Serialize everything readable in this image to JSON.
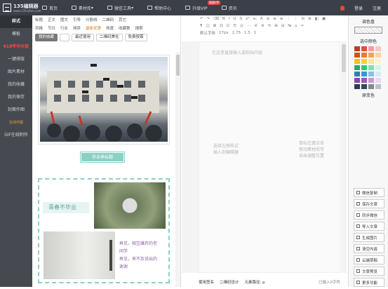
{
  "header": {
    "logo_title": "135编辑器",
    "logo_sub": "www.135editor.com",
    "nav": [
      "首页",
      "素材库",
      "微信工具",
      "帮助中心",
      "升级VIP",
      "资讯"
    ],
    "vip_badge": "限量VIP",
    "login": "登录",
    "register": "注册"
  },
  "sidebar": {
    "items": [
      "样式",
      "模板",
      "618年中大促",
      "一键排版",
      "图片素材",
      "我的收藏",
      "我的保存",
      "封面作图",
      "在线作图",
      "GIF在线制作"
    ]
  },
  "filters": {
    "row1": [
      "标题",
      "正文",
      "图文",
      "引导",
      "分割线",
      "二维码",
      "其它"
    ],
    "row2": [
      "风格",
      "节日",
      "行业",
      "排序",
      "最新优惠",
      "热度",
      "收藏数",
      "搜索"
    ],
    "tabs": [
      "我的收藏",
      "最近使用",
      "二维码美化",
      "免费按需"
    ]
  },
  "material": {
    "title_label": "毕业季标题",
    "card2_heading": "青春不毕业",
    "poem": "再见，相互嫌弃的老\n同学\n再见，来不及说出的\n谢谢"
  },
  "editor": {
    "toolbar_row3": [
      "默认字体",
      "17px",
      "1.75",
      "1.5",
      "1"
    ],
    "hint_top": "在这里直接输入或粘贴内容",
    "hint_left": "选择左侧样式\n插入到编辑器",
    "hint_right": "鼠标左键点击\n拖动素材后可\n自由调整位置",
    "status": [
      "使用签名",
      "二维码设计",
      "元素路径: p",
      "已输入0字符"
    ]
  },
  "right_panel": {
    "color_title": "调色盘",
    "selected_color_title": "选中颜色",
    "color_mode": "原变色",
    "colors": [
      "#c0392b",
      "#e74c3c",
      "#f39c9c",
      "#f7c6c6",
      "#d35400",
      "#e67e22",
      "#f0a35e",
      "#f8d4a8",
      "#f1c40f",
      "#f4d03f",
      "#f9e79f",
      "#fcf3cf",
      "#27ae60",
      "#2ecc71",
      "#82e0aa",
      "#d5f5e3",
      "#2980b9",
      "#3498db",
      "#85c1e9",
      "#d6eaf8",
      "#8e44ad",
      "#9b59b6",
      "#c39bd3",
      "#e8daef",
      "#2c3e50",
      "#34495e",
      "#7f8c8d",
      "#bdc3c7"
    ],
    "buttons": [
      "微信复制",
      "保存文章",
      "同步微信",
      "导入文章",
      "生成图片",
      "清空内容",
      "云端草稿",
      "文章预览",
      "更多功能"
    ]
  }
}
